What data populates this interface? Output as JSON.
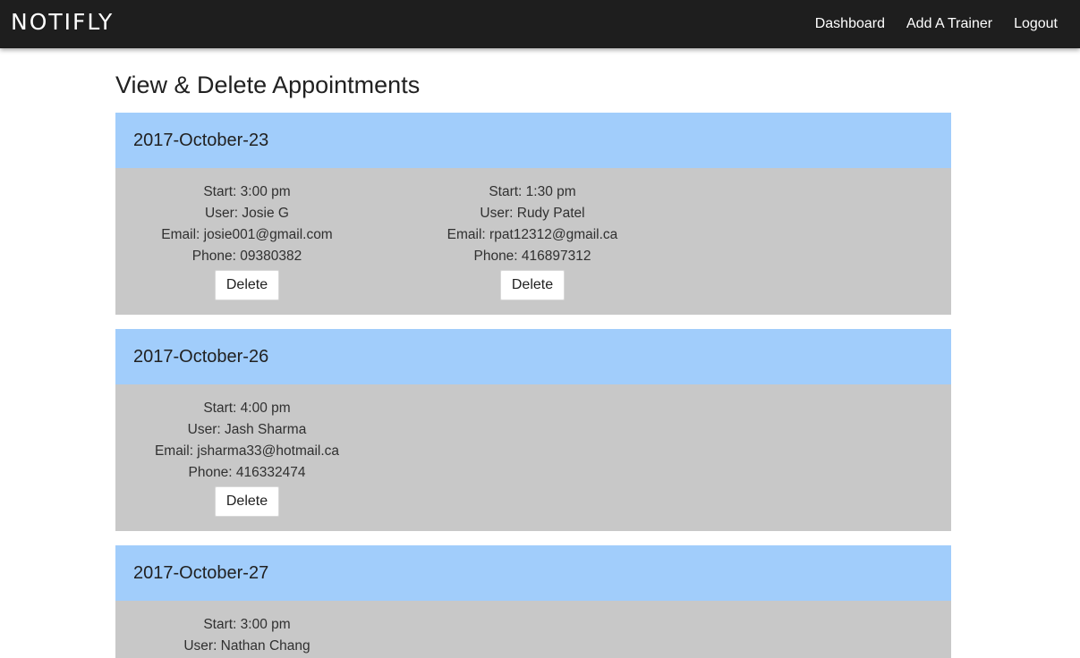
{
  "navbar": {
    "brand": "NOTIFLY",
    "links": [
      "Dashboard",
      "Add A Trainer",
      "Logout"
    ]
  },
  "page_title": "View & Delete Appointments",
  "days": [
    {
      "date": "2017-October-23",
      "appointments": [
        {
          "start": "Start: 3:00 pm",
          "user": "User: Josie G",
          "email": "Email: josie001@gmail.com",
          "phone": "Phone: 09380382",
          "delete_label": "Delete"
        },
        {
          "start": "Start: 1:30 pm",
          "user": "User: Rudy Patel",
          "email": "Email: rpat12312@gmail.ca",
          "phone": "Phone: 416897312",
          "delete_label": "Delete"
        }
      ]
    },
    {
      "date": "2017-October-26",
      "appointments": [
        {
          "start": "Start: 4:00 pm",
          "user": "User: Jash Sharma",
          "email": "Email: jsharma33@hotmail.ca",
          "phone": "Phone: 416332474",
          "delete_label": "Delete"
        }
      ]
    },
    {
      "date": "2017-October-27",
      "appointments": [
        {
          "start": "Start: 3:00 pm",
          "user": "User: Nathan Chang"
        }
      ]
    }
  ]
}
